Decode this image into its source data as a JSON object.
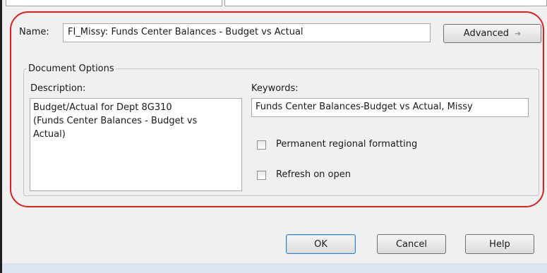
{
  "name": {
    "label": "Name:",
    "value": "FI_Missy: Funds Center Balances - Budget vs Actual"
  },
  "advanced": {
    "label": "Advanced",
    "icon": "arrow-up-icon"
  },
  "document_options": {
    "title": "Document Options",
    "description": {
      "label": "Description:",
      "lines": [
        "Budget/Actual for Dept 8G310",
        "(Funds Center Balances - Budget vs",
        "Actual)"
      ]
    },
    "keywords": {
      "label": "Keywords:",
      "value": "Funds Center Balances-Budget vs Actual, Missy"
    },
    "permanent_regional_formatting": {
      "label": "Permanent regional formatting",
      "checked": false
    },
    "refresh_on_open": {
      "label": "Refresh on open",
      "checked": false
    }
  },
  "buttons": {
    "ok": "OK",
    "cancel": "Cancel",
    "help": "Help"
  },
  "colors": {
    "highlight": "#e01f1f",
    "dialog_bg": "#f0f0f0",
    "ok_border": "#3c7fb1"
  }
}
